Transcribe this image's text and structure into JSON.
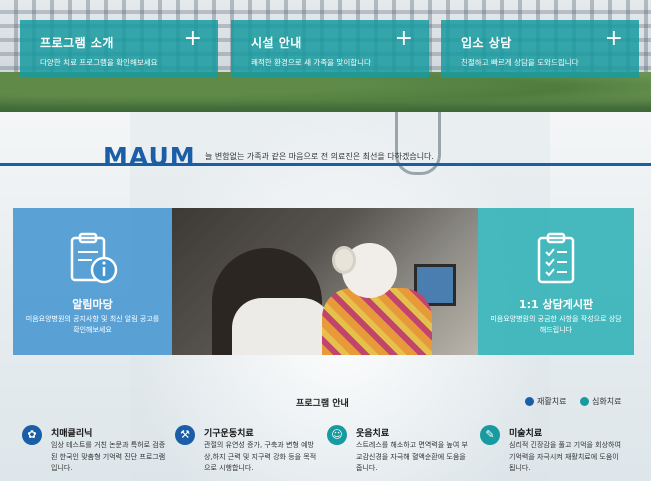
{
  "hero": {
    "boxes": [
      {
        "title": "프로그램 소개",
        "plus": "+",
        "desc": "다양한 치료 프로그램을 확인해보세요"
      },
      {
        "title": "시설 안내",
        "plus": "+",
        "desc": "쾌적한 환경으로 새 가족을 맞이합니다"
      },
      {
        "title": "입소 상담",
        "plus": "+",
        "desc": "친절하고 빠르게 상담을 도와드립니다"
      }
    ]
  },
  "brand": {
    "name": "MAUM",
    "tagline": "늘 변함없는 가족과 같은 마음으로 전 의료진은 최선을 다하겠습니다."
  },
  "panels": {
    "left": {
      "title": "알림마당",
      "desc": "미음요양병원의 공지사항 및 최신 알림 공고를 확인해보세요",
      "icon": "notice-clipboard-icon"
    },
    "right": {
      "title": "1:1 상담게시판",
      "desc": "미음요양병원의 궁금한 사항을 작성으로 상담해드립니다",
      "icon": "checklist-clipboard-icon"
    }
  },
  "programs": {
    "heading": "프로그램 안내",
    "legend": [
      {
        "label": "재활치료",
        "color": "#1b5ea8"
      },
      {
        "label": "심화치료",
        "color": "#179aa0"
      }
    ],
    "items": [
      {
        "name": "치매클리닉",
        "desc": "임상 테스트를 거친 논문과 특허로 검증된 한국인 맞춤형 기억력 진단 프로그램입니다.",
        "color": "#1b5ea8",
        "icon": "brain-icon"
      },
      {
        "name": "기구운동치료",
        "desc": "관절의 유연성 증가, 구축과 변형 예방 상,하지 근력 및 지구력 강화 등을 목적으로 시행합니다.",
        "color": "#1b5ea8",
        "icon": "dumbbell-icon"
      },
      {
        "name": "웃음치료",
        "desc": "스트레스를 해소하고 면역력을 높여 부교감신경을 자극해 혈액순환에 도움을 줍니다.",
        "color": "#179aa0",
        "icon": "smile-icon"
      },
      {
        "name": "미술치료",
        "desc": "심리적 긴장감을 풀고 기억을 회상하여 기억력을 자극시켜 재활치료에 도움이 됩니다.",
        "color": "#179aa0",
        "icon": "palette-icon"
      }
    ]
  }
}
